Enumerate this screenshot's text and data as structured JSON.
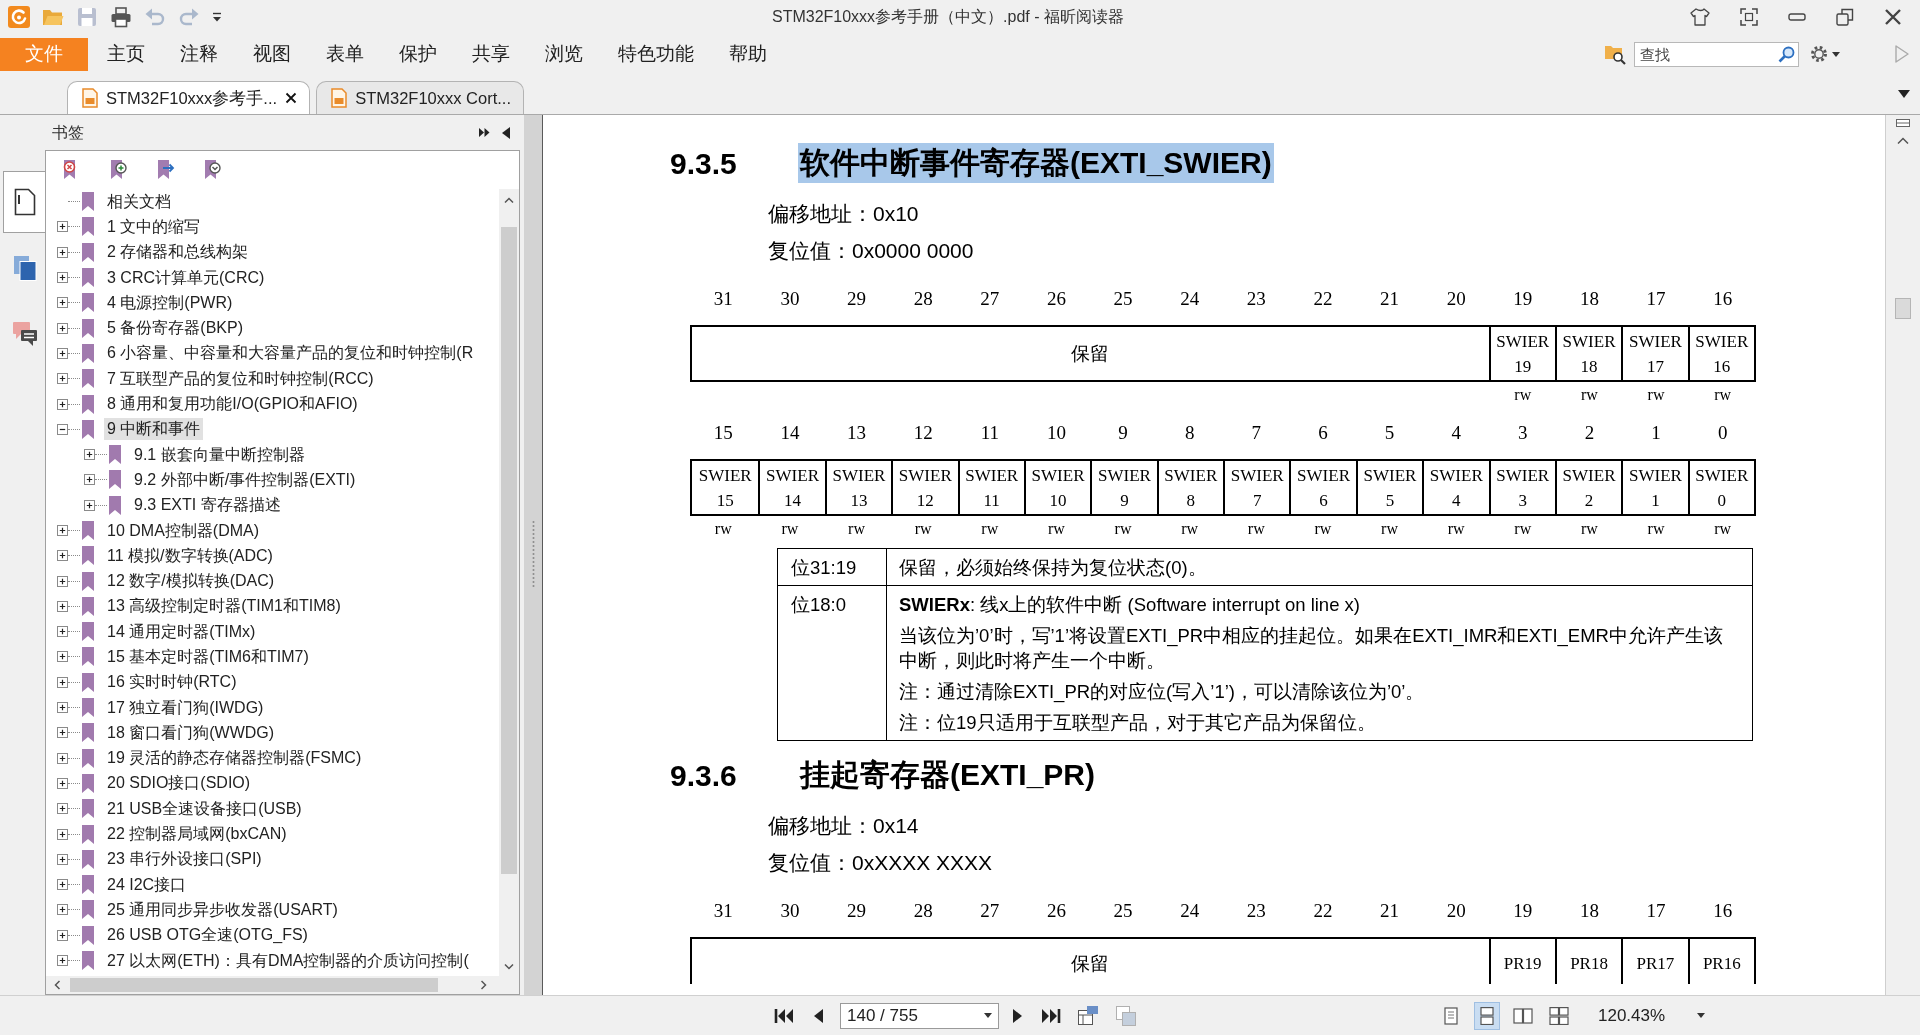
{
  "window": {
    "title": "STM32F10xxx参考手册（中文）.pdf - 福昕阅读器"
  },
  "quick_access": [
    {
      "disabled": false
    },
    {
      "disabled": true
    },
    {
      "disabled": false
    },
    {
      "disabled": true
    },
    {
      "disabled": true
    }
  ],
  "menu": {
    "file_button": "文件",
    "tabs": [
      {
        "label": "主页",
        "selected": false
      },
      {
        "label": "注释",
        "selected": false
      },
      {
        "label": "视图",
        "selected": false
      },
      {
        "label": "表单",
        "selected": false
      },
      {
        "label": "保护",
        "selected": false
      },
      {
        "label": "共享",
        "selected": false
      },
      {
        "label": "浏览",
        "selected": false
      },
      {
        "label": "特色功能",
        "selected": false
      },
      {
        "label": "帮助",
        "selected": false
      }
    ]
  },
  "search": {
    "placeholder": "查找"
  },
  "tabs": [
    {
      "label": "STM32F10xxx参考手...",
      "selected": true
    },
    {
      "label": "STM32F10xxx Cort...",
      "selected": false
    }
  ],
  "sidebar": {
    "title": "书签",
    "panels": [
      {
        "selected": true
      },
      {
        "selected": false
      },
      {
        "selected": false
      }
    ]
  },
  "bookmarks": [
    {
      "label": "相关文档",
      "selected": false
    },
    {
      "label": "1 文中的缩写",
      "expanded": false,
      "selected": false
    },
    {
      "label": "2 存储器和总线构架",
      "expanded": false,
      "selected": false
    },
    {
      "label": "3 CRC计算单元(CRC)",
      "expanded": false,
      "selected": false
    },
    {
      "label": "4 电源控制(PWR)",
      "expanded": false,
      "selected": false
    },
    {
      "label": "5 备份寄存器(BKP)",
      "expanded": false,
      "selected": false
    },
    {
      "label": "6 小容量、中容量和大容量产品的复位和时钟控制(R",
      "expanded": false,
      "selected": false
    },
    {
      "label": "7 互联型产品的复位和时钟控制(RCC)",
      "expanded": false,
      "selected": false
    },
    {
      "label": "8 通用和复用功能I/O(GPIO和AFIO)",
      "expanded": false,
      "selected": false
    },
    {
      "label": "9 中断和事件",
      "expanded": true,
      "selected": true,
      "children": [
        {
          "label": "9.1 嵌套向量中断控制器",
          "expanded": false,
          "selected": false
        },
        {
          "label": "9.2 外部中断/事件控制器(EXTI)",
          "expanded": false,
          "selected": false
        },
        {
          "label": "9.3 EXTI 寄存器描述",
          "expanded": false,
          "selected": false
        }
      ]
    },
    {
      "label": "10 DMA控制器(DMA)",
      "expanded": false,
      "selected": false
    },
    {
      "label": "11 模拟/数字转换(ADC)",
      "expanded": false,
      "selected": false
    },
    {
      "label": "12 数字/模拟转换(DAC)",
      "expanded": false,
      "selected": false
    },
    {
      "label": "13 高级控制定时器(TIM1和TIM8)",
      "expanded": false,
      "selected": false
    },
    {
      "label": "14 通用定时器(TIMx)",
      "expanded": false,
      "selected": false
    },
    {
      "label": "15 基本定时器(TIM6和TIM7)",
      "expanded": false,
      "selected": false
    },
    {
      "label": "16 实时时钟(RTC)",
      "expanded": false,
      "selected": false
    },
    {
      "label": "17 独立看门狗(IWDG)",
      "expanded": false,
      "selected": false
    },
    {
      "label": "18 窗口看门狗(WWDG)",
      "expanded": false,
      "selected": false
    },
    {
      "label": "19 灵活的静态存储器控制器(FSMC)",
      "expanded": false,
      "selected": false
    },
    {
      "label": "20 SDIO接口(SDIO)",
      "expanded": false,
      "selected": false
    },
    {
      "label": "21 USB全速设备接口(USB)",
      "expanded": false,
      "selected": false
    },
    {
      "label": "22 控制器局域网(bxCAN)",
      "expanded": false,
      "selected": false
    },
    {
      "label": "23 串行外设接口(SPI)",
      "expanded": false,
      "selected": false
    },
    {
      "label": "24 I2C接口",
      "expanded": false,
      "selected": false
    },
    {
      "label": "25 通用同步异步收发器(USART)",
      "expanded": false,
      "selected": false
    },
    {
      "label": "26 USB OTG全速(OTG_FS)",
      "expanded": false,
      "selected": false
    },
    {
      "label": "27 以太网(ETH)：具有DMA控制器的介质访问控制(",
      "expanded": false,
      "selected": false
    }
  ],
  "document": {
    "sections": [
      {
        "number": "9.3.5",
        "title": "软件中断事件寄存器(EXTI_SWIER)",
        "highlighted": true,
        "offset": "偏移地址：0x10",
        "reset_value": "复位值：0x0000 0000",
        "registers": [
          {
            "bits": [
              "31",
              "30",
              "29",
              "28",
              "27",
              "26",
              "25",
              "24",
              "23",
              "22",
              "21",
              "20",
              "19",
              "18",
              "17",
              "16"
            ],
            "fields": [
              {
                "kind": "reserved",
                "label": "保留"
              },
              {
                "kind": "field",
                "label": "SWIER 19",
                "access": "rw"
              },
              {
                "kind": "field",
                "label": "SWIER 18",
                "access": "rw"
              },
              {
                "kind": "field",
                "label": "SWIER 17",
                "access": "rw"
              },
              {
                "kind": "field",
                "label": "SWIER 16",
                "access": "rw"
              }
            ]
          },
          {
            "bits": [
              "15",
              "14",
              "13",
              "12",
              "11",
              "10",
              "9",
              "8",
              "7",
              "6",
              "5",
              "4",
              "3",
              "2",
              "1",
              "0"
            ],
            "fields": [
              {
                "kind": "field",
                "label": "SWIER 15",
                "access": "rw"
              },
              {
                "kind": "field",
                "label": "SWIER 14",
                "access": "rw"
              },
              {
                "kind": "field",
                "label": "SWIER 13",
                "access": "rw"
              },
              {
                "kind": "field",
                "label": "SWIER 12",
                "access": "rw"
              },
              {
                "kind": "field",
                "label": "SWIER 11",
                "access": "rw"
              },
              {
                "kind": "field",
                "label": "SWIER 10",
                "access": "rw"
              },
              {
                "kind": "field",
                "label": "SWIER 9",
                "access": "rw"
              },
              {
                "kind": "field",
                "label": "SWIER 8",
                "access": "rw"
              },
              {
                "kind": "field",
                "label": "SWIER 7",
                "access": "rw"
              },
              {
                "kind": "field",
                "label": "SWIER 6",
                "access": "rw"
              },
              {
                "kind": "field",
                "label": "SWIER 5",
                "access": "rw"
              },
              {
                "kind": "field",
                "label": "SWIER 4",
                "access": "rw"
              },
              {
                "kind": "field",
                "label": "SWIER 3",
                "access": "rw"
              },
              {
                "kind": "field",
                "label": "SWIER 2",
                "access": "rw"
              },
              {
                "kind": "field",
                "label": "SWIER 1",
                "access": "rw"
              },
              {
                "kind": "field",
                "label": "SWIER 0",
                "access": "rw"
              }
            ]
          }
        ],
        "description": [
          {
            "bits": "位31:19",
            "paragraphs": [
              "保留，必须始终保持为复位状态(0)。"
            ]
          },
          {
            "bits": "位18:0",
            "paragraphs": [
              "**SWIERx**: 线x上的软件中断 (Software interrupt on line x)",
              "当该位为’0’时，写’1’将设置EXTI_PR中相应的挂起位。如果在EXTI_IMR和EXTI_EMR中允许产生该中断，则此时将产生一个中断。",
              "注：通过清除EXTI_PR的对应位(写入’1’)，可以清除该位为’0’。",
              "注：位19只适用于互联型产品，对于其它产品为保留位。"
            ]
          }
        ]
      },
      {
        "number": "9.3.6",
        "title": "挂起寄存器(EXTI_PR)",
        "highlighted": false,
        "offset": "偏移地址：0x14",
        "reset_value": "复位值：0xXXXX XXXX",
        "registers": [
          {
            "bits": [
              "31",
              "30",
              "29",
              "28",
              "27",
              "26",
              "25",
              "24",
              "23",
              "22",
              "21",
              "20",
              "19",
              "18",
              "17",
              "16"
            ],
            "fields": [
              {
                "kind": "reserved",
                "label": "保留"
              },
              {
                "kind": "field",
                "label": "PR19"
              },
              {
                "kind": "field",
                "label": "PR18"
              },
              {
                "kind": "field",
                "label": "PR17"
              },
              {
                "kind": "field",
                "label": "PR16"
              }
            ]
          }
        ]
      }
    ]
  },
  "page_nav": {
    "value": "140 / 755"
  },
  "page_tools": [
    {
      "disabled": false
    },
    {
      "disabled": true
    }
  ],
  "view_modes": [
    {
      "selected": false
    },
    {
      "selected": true
    },
    {
      "selected": false
    },
    {
      "selected": false
    }
  ],
  "zoom": {
    "value": "120.43%"
  }
}
